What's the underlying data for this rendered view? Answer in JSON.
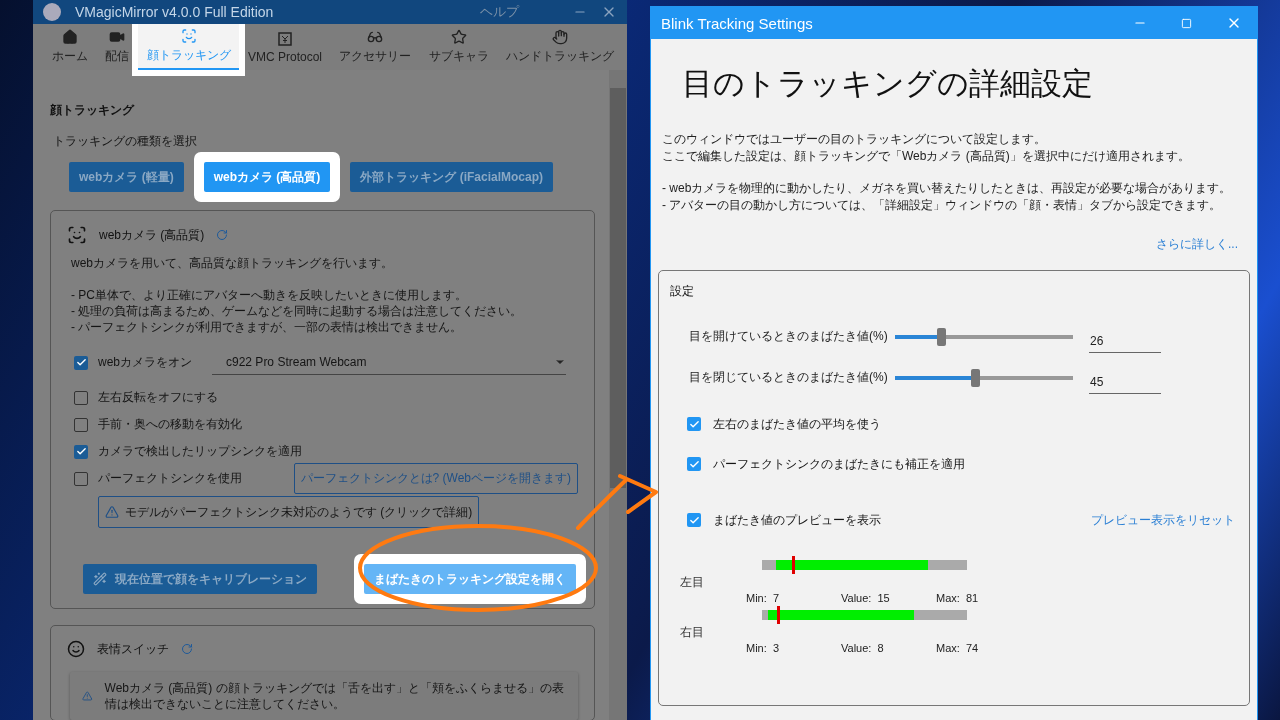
{
  "main_window": {
    "title": "VMagicMirror v4.0.0 Full Edition",
    "help": "ヘルプ",
    "tabs": [
      {
        "kind": "home",
        "label": "ホーム",
        "selected": false,
        "highlighted": false
      },
      {
        "kind": "stream",
        "label": "配信",
        "selected": false,
        "highlighted": false
      },
      {
        "kind": "face",
        "label": "顔トラッキング",
        "selected": true,
        "highlighted": true
      },
      {
        "kind": "protocol",
        "label": "VMC Protocol",
        "selected": false,
        "highlighted": false
      },
      {
        "kind": "accessory",
        "label": "アクセサリー",
        "selected": false,
        "highlighted": false
      },
      {
        "kind": "subchar",
        "label": "サブキャラ",
        "selected": false,
        "highlighted": false
      },
      {
        "kind": "hand",
        "label": "ハンドトラッキング",
        "selected": false,
        "highlighted": false
      }
    ],
    "section_title": "顔トラッキング",
    "tracking_type_label": "トラッキングの種類を選択",
    "tracking_types": [
      {
        "label": "webカメラ (軽量)",
        "selected": false,
        "highlighted": false
      },
      {
        "label": "webカメラ (高品質)",
        "selected": true,
        "highlighted": true
      },
      {
        "label": "外部トラッキング (iFacialMocap)",
        "selected": false,
        "highlighted": false
      }
    ],
    "webcam_card": {
      "title": "webカメラ (高品質)",
      "description": "webカメラを用いて、高品質な顔トラッキングを行います。",
      "notes": [
        "- PC単体で、より正確にアバターへ動きを反映したいときに使用します。",
        "- 処理の負荷は高まるため、ゲームなどを同時に起動する場合は注意してください。",
        "- パーフェクトシンクが利用できますが、一部の表情は検出できません。"
      ],
      "camera": {
        "label": "webカメラをオン",
        "checked": true,
        "device": "c922 Pro Stream Webcam"
      },
      "options": [
        {
          "label": "左右反転をオフにする",
          "checked": false
        },
        {
          "label": "手前・奥への移動を有効化",
          "checked": false
        },
        {
          "label": "カメラで検出したリップシンクを適用",
          "checked": true
        },
        {
          "label": "パーフェクトシンクを使用",
          "checked": false,
          "link": "パーフェクトシンクとは? (Webページを開きます)"
        }
      ],
      "warning": "モデルがパーフェクトシンク未対応のようです (クリックで詳細)",
      "calibrate_button": "現在位置で顔をキャリブレーション",
      "blink_button": {
        "label": "まばたきのトラッキング設定を開く",
        "highlighted": true
      }
    },
    "expression_card": {
      "title": "表情スイッチ",
      "warning": "Webカメラ (高品質) の顔トラッキングでは「舌を出す」と「頬をふくらませる」の表情は検出できないことに注意してください。"
    }
  },
  "blink_window": {
    "title": "Blink Tracking Settings",
    "heading": "目のトラッキングの詳細設定",
    "intro": [
      "このウィンドウではユーザーの目のトラッキングについて設定します。",
      "ここで編集した設定は、顔トラッキングで「Webカメラ (高品質)」を選択中にだけ適用されます。"
    ],
    "notes": [
      "- webカメラを物理的に動かしたり、メガネを買い替えたりしたときは、再設定が必要な場合があります。",
      "- アバターの目の動かし方については、「詳細設定」ウィンドウの「顔・表情」タブから設定できます。"
    ],
    "more_link": "さらに詳しく...",
    "settings": {
      "title": "設定",
      "sliders": [
        {
          "label": "目を開けているときのまばたき値(%)",
          "level": 0.26,
          "value": "26"
        },
        {
          "label": "目を閉じているときのまばたき値(%)",
          "level": 0.45,
          "value": "45"
        }
      ],
      "options": [
        {
          "label": "左右のまばたき値の平均を使う",
          "checked": true
        },
        {
          "label": "パーフェクトシンクのまばたきにも補正を適用",
          "checked": true
        }
      ],
      "preview_toggle": {
        "label": "まばたき値のプレビューを表示",
        "checked": true
      },
      "reset_link": "プレビュー表示をリセット",
      "previews": [
        {
          "label": "左目",
          "min": {
            "label": "Min:",
            "value": "7",
            "level": 0.07
          },
          "current": {
            "label": "Value:",
            "value": "15",
            "level": 0.15
          },
          "max": {
            "label": "Max:",
            "value": "81",
            "level": 0.81
          }
        },
        {
          "label": "右目",
          "min": {
            "label": "Min:",
            "value": "3",
            "level": 0.03
          },
          "current": {
            "label": "Value:",
            "value": "8",
            "level": 0.08
          },
          "max": {
            "label": "Max:",
            "value": "74",
            "level": 0.74
          }
        }
      ]
    }
  }
}
